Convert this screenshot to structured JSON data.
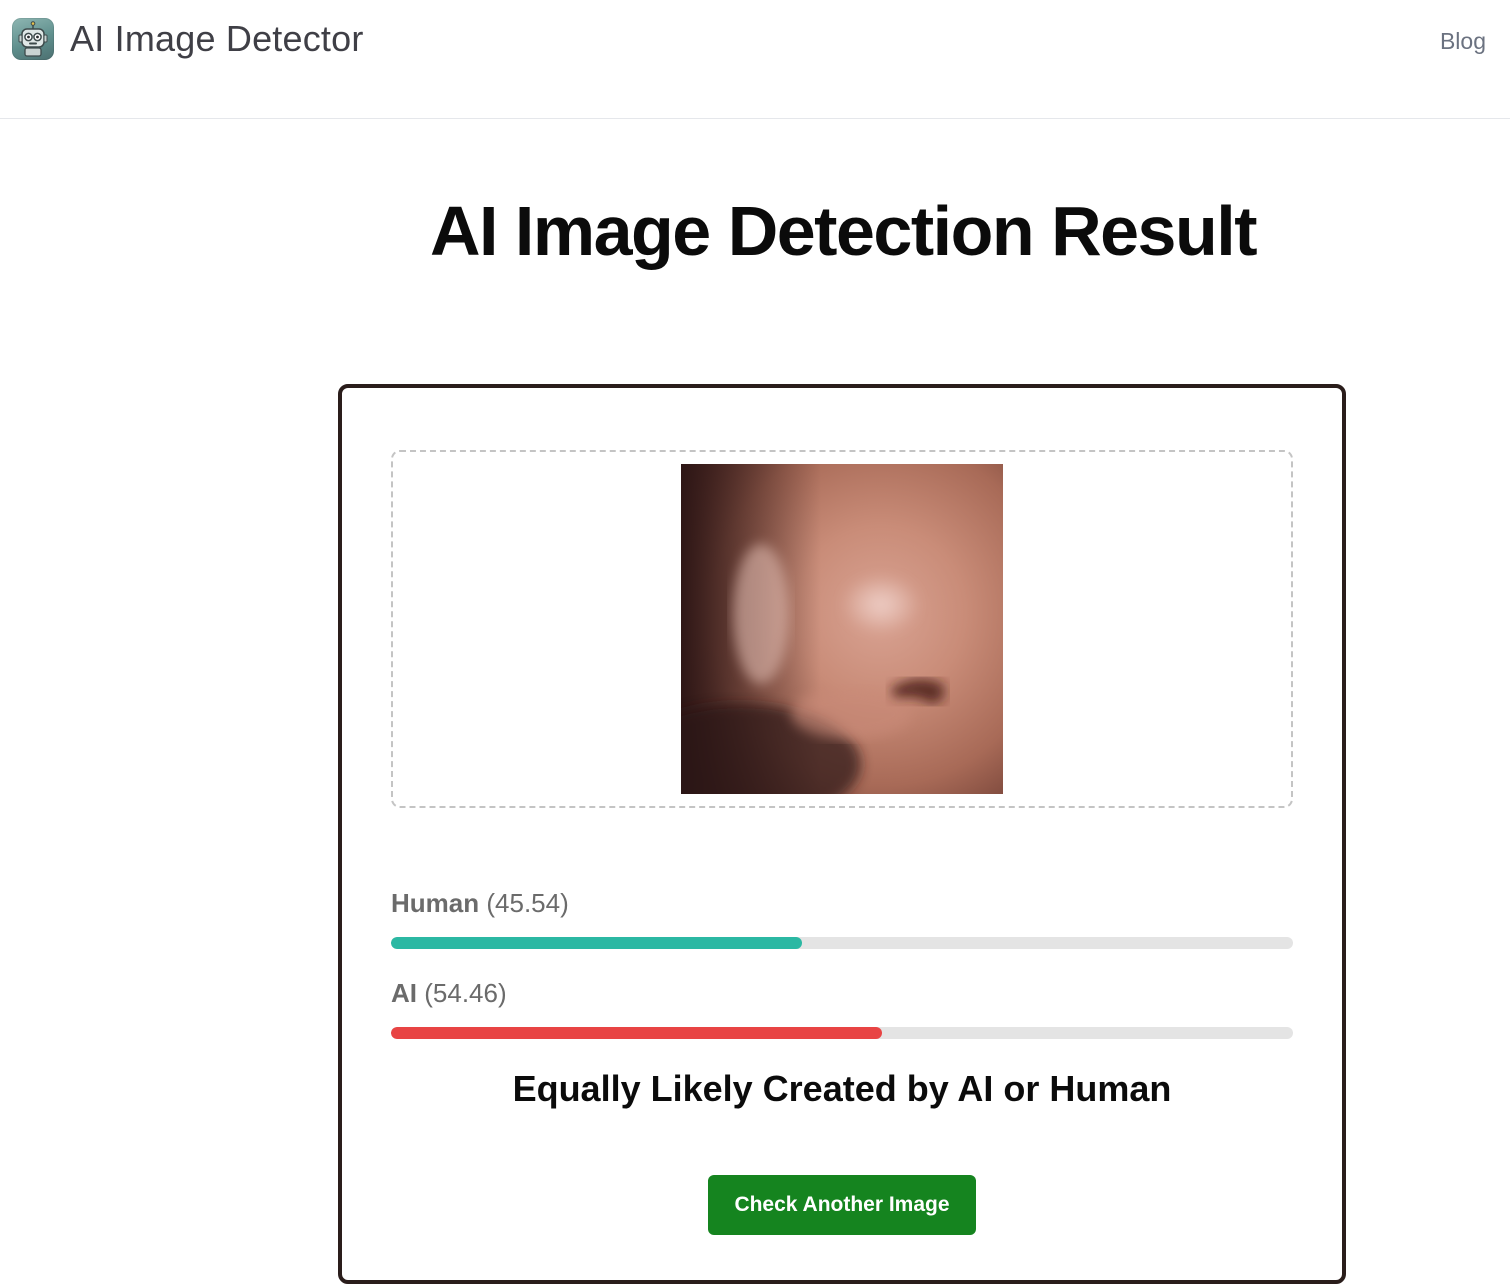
{
  "header": {
    "brand_title": "AI Image Detector",
    "nav_blog": "Blog"
  },
  "main": {
    "page_title": "AI Image Detection Result",
    "scores": [
      {
        "label": "Human",
        "value_text": "(45.54)",
        "fraction": 0.4554,
        "color": "#2bb8a3"
      },
      {
        "label": "AI",
        "value_text": "(54.46)",
        "fraction": 0.5446,
        "color": "#e84444"
      }
    ],
    "verdict": "Equally Likely Created by AI or Human",
    "cta_label": "Check Another Image",
    "preview_icon": "uploaded-image-preview"
  }
}
